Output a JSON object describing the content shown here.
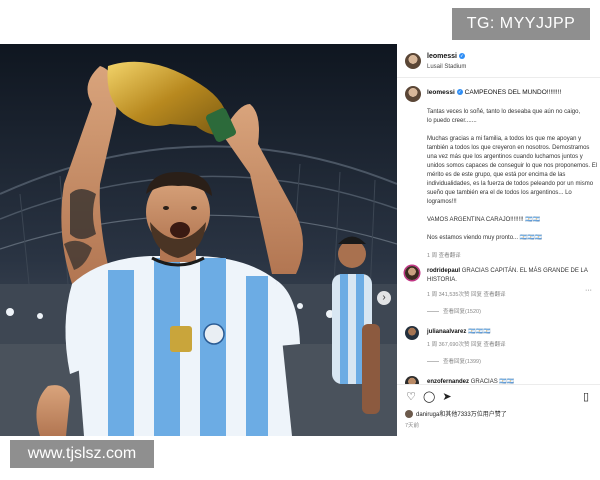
{
  "watermarks": {
    "top": "TG: MYYJJPP",
    "bottom": "www.tjslsz.com"
  },
  "post": {
    "username": "leomessi",
    "location": "Lusail Stadium",
    "caption_title": "CAMPEONES DEL MUNDO!!!!!!!!",
    "caption_lines": [
      "Tantas veces lo soñé, tanto lo deseaba que aún no caigo,",
      "lo puedo creer.......",
      "",
      "Muchas gracias a mi familia, a todos los que me apoyan y",
      "también a todos los que creyeron en nosotros. Demostramos",
      "una vez más que los argentinos cuando luchamos juntos y",
      "unidos somos capaces de conseguir lo que nos proponemos. El",
      "mérito es de este grupo, que está por encima de las",
      "individualidades, es la fuerza de todos peleando por un mismo",
      "sueño que también era el de todos los argentinos... Lo",
      "logramos!!!",
      "",
      "VAMOS ARGENTINA CARAJO!!!!!!!! 🇦🇷🇦🇷",
      "",
      "Nos estamos viendo muy pronto... 🇦🇷🇦🇷🇦🇷"
    ],
    "caption_meta": "1 周   查看翻译"
  },
  "comments": [
    {
      "username": "rodridepaul",
      "text": "GRACIAS CAPITÁN. EL MÁS GRANDE DE LA",
      "text2": "HISTORIA.",
      "meta": "1 周   341,535次赞   回复   查看翻译",
      "replies": "查看回复(1520)"
    },
    {
      "username": "julianaalvarez",
      "text": "🇦🇷🇦🇷🇦🇷",
      "meta": "1 周   367,690次赞   回复   查看翻译",
      "replies": "查看回复(1399)"
    },
    {
      "username": "enzofernandez",
      "text": "GRACIAS 🇦🇷🇦🇷"
    }
  ],
  "actions": {
    "liked_by": "daniruga和其他7333万位用户赞了",
    "time": "7天前"
  },
  "icons": {
    "like": "heart-icon",
    "comment": "comment-icon",
    "share": "send-icon",
    "save": "bookmark-icon",
    "more": "more-dots-icon",
    "next": "chevron-right-icon"
  },
  "colors": {
    "verified": "#2f8ef5",
    "watermark": "#8f8f8f",
    "argentina_blue": "#6cace4"
  }
}
